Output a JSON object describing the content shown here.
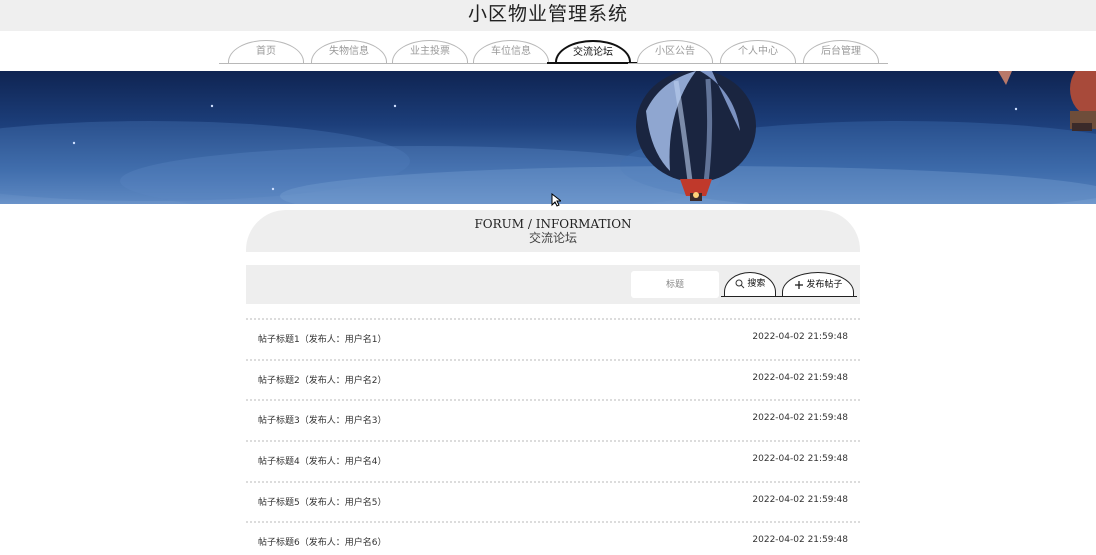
{
  "app": {
    "title": "小区物业管理系统"
  },
  "nav": {
    "tabs": [
      {
        "label": "首页",
        "active": false
      },
      {
        "label": "失物信息",
        "active": false
      },
      {
        "label": "业主投票",
        "active": false
      },
      {
        "label": "车位信息",
        "active": false
      },
      {
        "label": "交流论坛",
        "active": true
      },
      {
        "label": "小区公告",
        "active": false
      },
      {
        "label": "个人中心",
        "active": false
      },
      {
        "label": "后台管理",
        "active": false
      }
    ]
  },
  "section": {
    "title_en": "FORUM / INFORMATION",
    "title_cn": "交流论坛"
  },
  "search": {
    "placeholder": "标题",
    "value": "",
    "search_label": "搜索",
    "publish_label": "发布帖子"
  },
  "posts": [
    {
      "title": "帖子标题1（发布人：用户名1）",
      "time": "2022-04-02 21:59:48"
    },
    {
      "title": "帖子标题2（发布人：用户名2）",
      "time": "2022-04-02 21:59:48"
    },
    {
      "title": "帖子标题3（发布人：用户名3）",
      "time": "2022-04-02 21:59:48"
    },
    {
      "title": "帖子标题4（发布人：用户名4）",
      "time": "2022-04-02 21:59:48"
    },
    {
      "title": "帖子标题5（发布人：用户名5）",
      "time": "2022-04-02 21:59:48"
    },
    {
      "title": "帖子标题6（发布人：用户名6）",
      "time": "2022-04-02 21:59:48"
    }
  ],
  "icons": {
    "search": "search-icon",
    "publish": "plus-icon",
    "cursor": "mouse-cursor-icon"
  },
  "colors": {
    "accent": "#111111",
    "tab_inactive": "#9a9a9a",
    "panel": "#eeeeee"
  }
}
